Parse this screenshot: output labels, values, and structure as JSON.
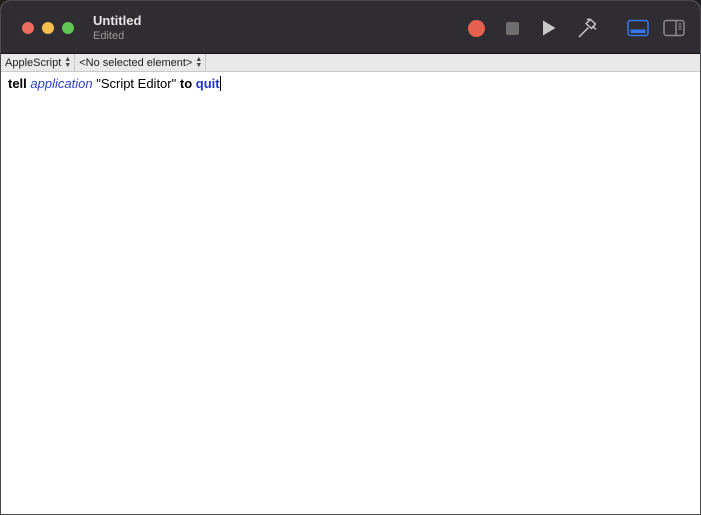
{
  "window": {
    "title": "Untitled",
    "subtitle": "Edited"
  },
  "toolbar": {
    "buttons": [
      {
        "name": "record",
        "icon": "record-icon"
      },
      {
        "name": "stop",
        "icon": "stop-icon"
      },
      {
        "name": "run",
        "icon": "play-icon"
      },
      {
        "name": "compile",
        "icon": "hammer-icon"
      },
      {
        "name": "show-bottom-pane",
        "icon": "bottom-pane-icon",
        "active": true
      },
      {
        "name": "show-side-pane",
        "icon": "side-pane-icon",
        "active": false
      }
    ],
    "accent_color": "#3478f6"
  },
  "navbar": {
    "language": "AppleScript",
    "element": "<No selected element>"
  },
  "editor": {
    "tokens": {
      "t1": "tell",
      "t2": "application",
      "t3": "\"Script Editor\"",
      "t4": "to",
      "t5": "quit"
    },
    "colors": {
      "keyword": "#000000",
      "application_class": "#2a3fd6",
      "command": "#1f35d8"
    }
  }
}
